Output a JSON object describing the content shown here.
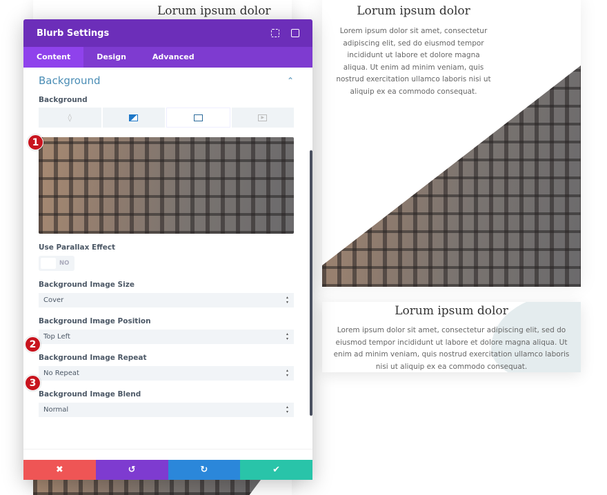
{
  "background_page": {
    "top_left_title": "Lorum ipsum dolor",
    "card1": {
      "title": "Lorum ipsum dolor",
      "text": "Lorem ipsum dolor sit amet, consectetur adipiscing elit, sed do eiusmod tempor incididunt ut labore et dolore magna aliqua. Ut enim ad minim veniam, quis nostrud exercitation ullamco laboris nisi ut aliquip ex ea commodo consequat."
    },
    "card2": {
      "title": "Lorum ipsum dolor",
      "text": "Lorem ipsum dolor sit amet, consectetur adipiscing elit, sed do eiusmod tempor incididunt ut labore et dolore magna aliqua. Ut enim ad minim veniam, quis nostrud exercitation ullamco laboris nisi ut aliquip ex ea commodo consequat."
    }
  },
  "panel": {
    "title": "Blurb Settings",
    "tabs": [
      {
        "label": "Content",
        "active": true
      },
      {
        "label": "Design"
      },
      {
        "label": "Advanced"
      }
    ],
    "section_title": "Background",
    "background_label": "Background",
    "background_types": [
      "color-icon",
      "gradient-icon",
      "image-icon",
      "video-icon"
    ],
    "active_background_type": "image",
    "parallax": {
      "label": "Use Parallax Effect",
      "value": "NO"
    },
    "fields": [
      {
        "label": "Background Image Size",
        "value": "Cover"
      },
      {
        "label": "Background Image Position",
        "value": "Top Left",
        "badge": "2"
      },
      {
        "label": "Background Image Repeat",
        "value": "No Repeat",
        "badge": "3"
      },
      {
        "label": "Background Image Blend",
        "value": "Normal"
      }
    ],
    "image_badge": "1",
    "footer": {
      "cancel": "✖",
      "undo": "↺",
      "redo": "↻",
      "save": "✔"
    },
    "colors": {
      "header": "#6c2eb9",
      "tabs": "#7e3bd0",
      "cancel": "#ef5555",
      "undo": "#7e3bd0",
      "redo": "#2b87da",
      "save": "#29c4a9",
      "section": "#4a8db5"
    }
  }
}
